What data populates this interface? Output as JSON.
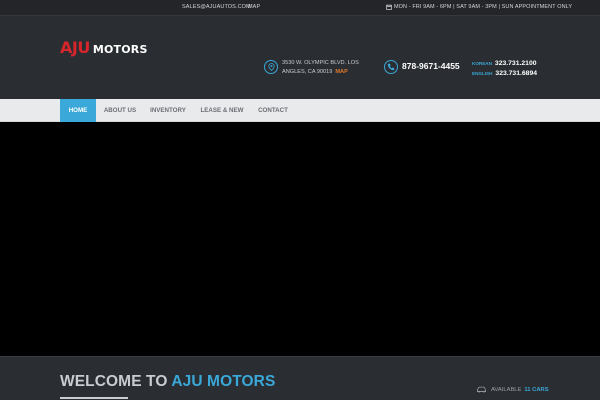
{
  "topbar": {
    "email": "SALES@AJUAUTOS.COM",
    "map_link": "MAP",
    "hours": "MON - FRI 9AM - 6PM | SAT 9AM - 3PM | SUN APPOINTMENT ONLY"
  },
  "logo": {
    "part1": "AJU",
    "part2": "MOTORS"
  },
  "address": {
    "line1": "3530 W. OLYMPIC BLVD. LOS",
    "line2": "ANGLES, CA 90019",
    "map_label": "MAP"
  },
  "phone": {
    "main": "878-9671-4455"
  },
  "languages": [
    {
      "label": "KOREAN",
      "number": "323.731.2100"
    },
    {
      "label": "ENGLISH",
      "number": "323.731.6894"
    }
  ],
  "nav": [
    {
      "label": "HOME",
      "active": true
    },
    {
      "label": "ABOUT US",
      "active": false
    },
    {
      "label": "INVENTORY",
      "active": false
    },
    {
      "label": "LEASE & NEW",
      "active": false
    },
    {
      "label": "CONTACT",
      "active": false
    }
  ],
  "welcome": {
    "prefix": "WELCOME TO",
    "brand": "AJU MOTORS"
  },
  "available": {
    "label": "AVAILABLE",
    "count": "11 CARS"
  },
  "colors": {
    "accent": "#3aa8d8",
    "logo_red": "#d7262b",
    "map_orange": "#e07a2c",
    "background": "#26292e"
  },
  "icons": [
    "calendar-icon",
    "map-pin-icon",
    "phone-icon",
    "car-icon"
  ]
}
